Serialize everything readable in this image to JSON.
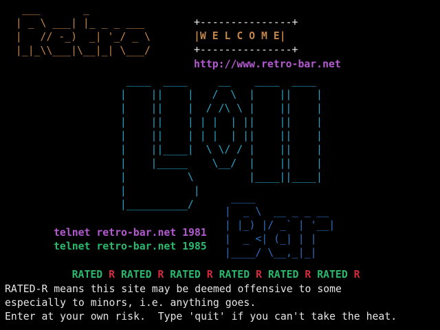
{
  "colors": {
    "background": "#000000",
    "orange": "#c3854a",
    "cyan": "#2aa3c4",
    "blue": "#2f6fc2",
    "white": "#e6e6e6",
    "magenta": "#b45ad1",
    "green": "#2cb96e",
    "red": "#d42b3b"
  },
  "banner": {
    "retro_art": [
      "  ___       _",
      " | _ \\ ___| |_ _ _ ___",
      " |   // -_)  _| '_/ _ \\",
      " |_|_\\\\___|\\__|_| \\___/"
    ],
    "box_top": "+---------------+",
    "welcome_line": "|W E L C O M E|",
    "box_bottom": "+---------------+",
    "url": "http://www.retro-bar.net"
  },
  "lol_art": [
    "  ____  ____     __    ____  ____",
    " |    ||    |   /  \\  |    ||    |",
    " |    ||    |  / /\\ \\ |    ||    |",
    " |    ||    | | |  | ||    ||    |",
    " |    ||    | | |  | ||    ||    |",
    " |    ||____|  \\ \\/ / |    ||    |",
    " |    |_____    \\__/  |    ||    |",
    " |          \\         |____||____|",
    " |           |",
    " |__________/"
  ],
  "bar_art": [
    "  ____",
    " |  _ \\  __ _ _ __",
    " | |_) |/ _` | '__|",
    " |  _ <| (_| | |",
    " |____/ \\__,_|_|"
  ],
  "telnet": {
    "line_1981": "telnet retro-bar.net 1981",
    "line_1985": "telnet retro-bar.net 1985"
  },
  "rated": {
    "word": "RATED",
    "letter": "R"
  },
  "notice": {
    "line1": "RATED-R means this site may be deemed offensive to some",
    "line2": "especially to minors, i.e. anything goes.",
    "line3": "Enter at your own risk.  Type 'quit' if you can't take the heat."
  }
}
